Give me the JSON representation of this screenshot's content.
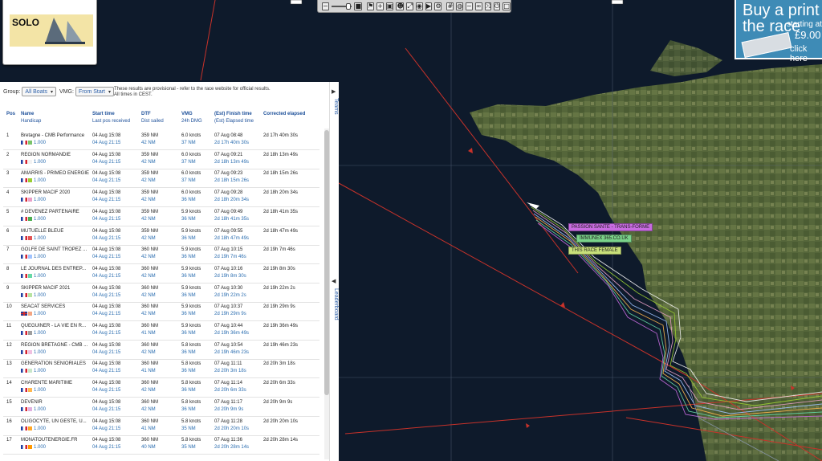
{
  "colors": {
    "sea": "#0e1a2b",
    "land": "#5a6b3a",
    "panel_link": "#2a6db0",
    "ad_bg": "#3e8bb6"
  },
  "logo": {
    "text": "SOLO"
  },
  "toolbar": {
    "icons": [
      "zoom-out-icon",
      "zoom-in-icon",
      "flag-icon",
      "plus-icon",
      "layers-icon",
      "group-icon",
      "fullscreen-icon",
      "camera-icon",
      "play-icon",
      "settings-icon",
      "grid-icon",
      "globe-icon",
      "wind-icon",
      "link-icon",
      "shuffle-icon",
      "power-icon",
      "square-icon"
    ]
  },
  "ad": {
    "line1": "Buy a print of",
    "line2": "the race",
    "line3": "starting at",
    "price": "£9.00",
    "click": "click here"
  },
  "filters": {
    "group_label": "Group:",
    "group_value": "All Boats",
    "vmg_label": "VMG:",
    "vmg_value": "From Start",
    "notice_line1": "These results are provisional - refer to the race website for official results.",
    "notice_line2": "All times in CEST."
  },
  "columns": {
    "pos": "Pos",
    "name": "Name",
    "handicap": "Handicap",
    "start": "Start time",
    "lastpos": "Last pos received",
    "dtf": "DTF",
    "sailed": "Dist sailed",
    "vmg": "VMG",
    "dmg": "24h DMG",
    "finish": "(Est) Finish time",
    "elapsed": "(Est) Elapsed time",
    "corrected": "Corrected elapsed"
  },
  "rows": [
    {
      "pos": "1",
      "name": "Bretagne - CMB Performance",
      "flag": "fr",
      "color": "#7ac36a",
      "handicap": "1.000",
      "start": "04 Aug 15:08",
      "last": "04 Aug 21:15",
      "dtf": "359 NM",
      "sailed": "42 NM",
      "vmg": "6.0 knots",
      "dmg": "37 NM",
      "finish": "07 Aug 08:48",
      "elapsed": "2d 17h 40m 30s",
      "corrected": "2d 17h 40m 30s"
    },
    {
      "pos": "2",
      "name": "REGION NORMANDIE",
      "flag": "fr",
      "color": "#f2f2f2",
      "handicap": "1.000",
      "start": "04 Aug 15:08",
      "last": "04 Aug 21:15",
      "dtf": "359 NM",
      "sailed": "42 NM",
      "vmg": "6.0 knots",
      "dmg": "37 NM",
      "finish": "07 Aug 09:21",
      "elapsed": "2d 18h 13m 49s",
      "corrected": "2d 18h 13m 49s"
    },
    {
      "pos": "3",
      "name": "AMARRIS - PRIMEO ENERGIE",
      "flag": "fr",
      "color": "#9acd32",
      "handicap": "1.000",
      "start": "04 Aug 15:08",
      "last": "04 Aug 21:15",
      "dtf": "359 NM",
      "sailed": "42 NM",
      "vmg": "6.0 knots",
      "dmg": "37 NM",
      "finish": "07 Aug 09:23",
      "elapsed": "2d 18h 15m 26s",
      "corrected": "2d 18h 15m 26s"
    },
    {
      "pos": "4",
      "name": "SKIPPER MACIF 2020",
      "flag": "fr",
      "color": "#e9a0c8",
      "handicap": "1.000",
      "start": "04 Aug 15:08",
      "last": "04 Aug 21:15",
      "dtf": "359 NM",
      "sailed": "42 NM",
      "vmg": "6.0 knots",
      "dmg": "36 NM",
      "finish": "07 Aug 09:28",
      "elapsed": "2d 18h 20m 34s",
      "corrected": "2d 18h 20m 34s"
    },
    {
      "pos": "5",
      "name": "# DEVENEZ PARTENAIRE",
      "flag": "fr",
      "color": "#4caf50",
      "handicap": "1.000",
      "start": "04 Aug 15:08",
      "last": "04 Aug 21:15",
      "dtf": "359 NM",
      "sailed": "42 NM",
      "vmg": "5.9 knots",
      "dmg": "36 NM",
      "finish": "07 Aug 09:49",
      "elapsed": "2d 18h 41m 35s",
      "corrected": "2d 18h 41m 35s"
    },
    {
      "pos": "6",
      "name": "MUTUELLE BLEUE",
      "flag": "fr",
      "color": "#e25555",
      "handicap": "1.000",
      "start": "04 Aug 15:08",
      "last": "04 Aug 21:15",
      "dtf": "359 NM",
      "sailed": "42 NM",
      "vmg": "5.9 knots",
      "dmg": "36 NM",
      "finish": "07 Aug 09:55",
      "elapsed": "2d 18h 47m 49s",
      "corrected": "2d 18h 47m 49s"
    },
    {
      "pos": "7",
      "name": "GOLFE DE SAINT TROPEZ ...",
      "flag": "fr",
      "color": "#a0c4ff",
      "handicap": "1.000",
      "start": "04 Aug 15:08",
      "last": "04 Aug 21:15",
      "dtf": "360 NM",
      "sailed": "42 NM",
      "vmg": "5.9 knots",
      "dmg": "36 NM",
      "finish": "07 Aug 10:15",
      "elapsed": "2d 19h 7m 46s",
      "corrected": "2d 19h 7m 46s"
    },
    {
      "pos": "8",
      "name": "LE JOURNAL DES ENTREP...",
      "flag": "fr",
      "color": "#66d9a6",
      "handicap": "1.000",
      "start": "04 Aug 15:08",
      "last": "04 Aug 21:15",
      "dtf": "360 NM",
      "sailed": "42 NM",
      "vmg": "5.9 knots",
      "dmg": "36 NM",
      "finish": "07 Aug 10:16",
      "elapsed": "2d 19h 8m 30s",
      "corrected": "2d 19h 8m 30s"
    },
    {
      "pos": "9",
      "name": "SKIPPER MACIF 2021",
      "flag": "fr",
      "color": "#b6e3a0",
      "handicap": "1.000",
      "start": "04 Aug 15:08",
      "last": "04 Aug 21:15",
      "dtf": "360 NM",
      "sailed": "42 NM",
      "vmg": "5.9 knots",
      "dmg": "36 NM",
      "finish": "07 Aug 10:30",
      "elapsed": "2d 19h 22m 2s",
      "corrected": "2d 19h 22m 2s"
    },
    {
      "pos": "10",
      "name": "SEACAT SERVICES",
      "flag": "gb",
      "color": "#f4a582",
      "handicap": "1.000",
      "start": "04 Aug 15:08",
      "last": "04 Aug 21:15",
      "dtf": "360 NM",
      "sailed": "42 NM",
      "vmg": "5.9 knots",
      "dmg": "36 NM",
      "finish": "07 Aug 10:37",
      "elapsed": "2d 19h 29m 9s",
      "corrected": "2d 19h 29m 9s"
    },
    {
      "pos": "11",
      "name": "QUEGUINER - LA VIE EN R...",
      "flag": "fr",
      "color": "#9e9e9e",
      "handicap": "1.000",
      "start": "04 Aug 15:08",
      "last": "04 Aug 21:15",
      "dtf": "360 NM",
      "sailed": "41 NM",
      "vmg": "5.9 knots",
      "dmg": "36 NM",
      "finish": "07 Aug 10:44",
      "elapsed": "2d 19h 36m 49s",
      "corrected": "2d 19h 36m 49s"
    },
    {
      "pos": "12",
      "name": "REGION BRETAGNE - CMB ...",
      "flag": "fr",
      "color": "#f0c0e0",
      "handicap": "1.000",
      "start": "04 Aug 15:08",
      "last": "04 Aug 21:15",
      "dtf": "360 NM",
      "sailed": "42 NM",
      "vmg": "5.8 knots",
      "dmg": "36 NM",
      "finish": "07 Aug 10:54",
      "elapsed": "2d 19h 46m 23s",
      "corrected": "2d 19h 46m 23s"
    },
    {
      "pos": "13",
      "name": "GENERATION SENIORIALES",
      "flag": "fr",
      "color": "#c8e6c9",
      "handicap": "1.000",
      "start": "04 Aug 15:08",
      "last": "04 Aug 21:15",
      "dtf": "360 NM",
      "sailed": "41 NM",
      "vmg": "5.8 knots",
      "dmg": "36 NM",
      "finish": "07 Aug 11:11",
      "elapsed": "2d 20h 3m 18s",
      "corrected": "2d 20h 3m 18s"
    },
    {
      "pos": "14",
      "name": "CHARENTE MARITIME",
      "flag": "fr",
      "color": "#ffb74d",
      "handicap": "1.000",
      "start": "04 Aug 15:08",
      "last": "04 Aug 21:15",
      "dtf": "360 NM",
      "sailed": "42 NM",
      "vmg": "5.8 knots",
      "dmg": "36 NM",
      "finish": "07 Aug 11:14",
      "elapsed": "2d 20h 6m 33s",
      "corrected": "2d 20h 6m 33s"
    },
    {
      "pos": "15",
      "name": "DEVENIR",
      "flag": "fr",
      "color": "#e0b0e0",
      "handicap": "1.000",
      "start": "04 Aug 15:08",
      "last": "04 Aug 21:15",
      "dtf": "360 NM",
      "sailed": "42 NM",
      "vmg": "5.8 knots",
      "dmg": "36 NM",
      "finish": "07 Aug 11:17",
      "elapsed": "2d 20h 9m 9s",
      "corrected": "2d 20h 9m 9s"
    },
    {
      "pos": "16",
      "name": "OLIGOCYTE, UN GESTE, U...",
      "flag": "fr",
      "color": "#ffa726",
      "handicap": "1.000",
      "start": "04 Aug 15:08",
      "last": "04 Aug 21:15",
      "dtf": "360 NM",
      "sailed": "41 NM",
      "vmg": "5.8 knots",
      "dmg": "35 NM",
      "finish": "07 Aug 11:28",
      "elapsed": "2d 20h 20m 10s",
      "corrected": "2d 20h 20m 10s"
    },
    {
      "pos": "17",
      "name": "MONATOUTENERGIE.FR",
      "flag": "fr",
      "color": "#ff9800",
      "handicap": "1.000",
      "start": "04 Aug 15:08",
      "last": "04 Aug 21:15",
      "dtf": "360 NM",
      "sailed": "40 NM",
      "vmg": "5.8 knots",
      "dmg": "35 NM",
      "finish": "07 Aug 11:36",
      "elapsed": "2d 20h 28m 14s",
      "corrected": "2d 20h 28m 14s"
    }
  ],
  "side_tabs": {
    "teams": "Teams",
    "leaderboard": "Leaderboard"
  },
  "map_labels": [
    {
      "text": "PASSION SANTE - TRANS-FORME",
      "color": "#c86be0"
    },
    {
      "text": "IMMUNEX 365.CO.UK",
      "color": "#7ad38a"
    },
    {
      "text": "THIS RACE FEMALE",
      "color": "#c8e07a"
    }
  ]
}
